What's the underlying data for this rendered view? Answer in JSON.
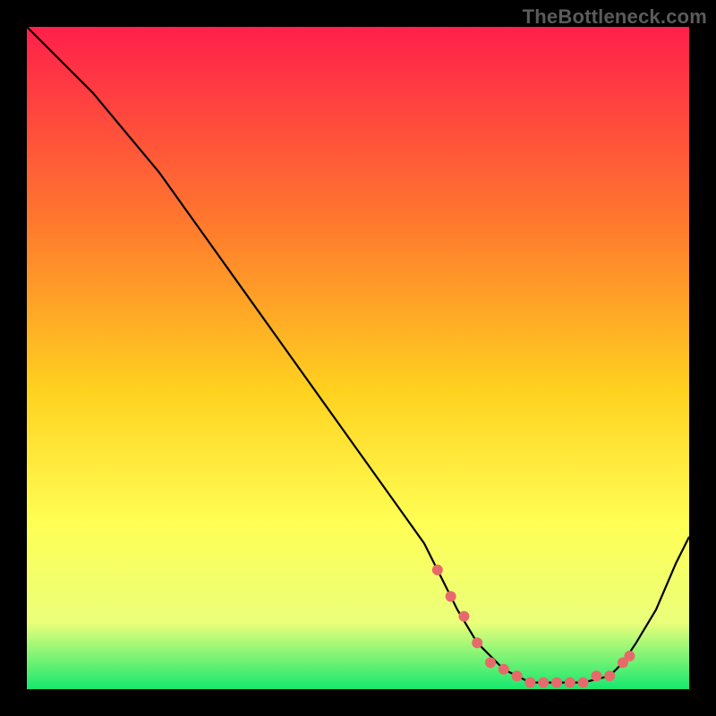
{
  "watermark": "TheBottleneck.com",
  "colors": {
    "gradient_top": "#ff1f4b",
    "gradient_mid1": "#ff7a2d",
    "gradient_mid2": "#ffd21f",
    "gradient_mid3": "#ffff55",
    "gradient_mid4": "#eaff7a",
    "gradient_bottom": "#16e86f",
    "curve": "#000000",
    "dots": "#e76a6a",
    "frame": "#000000"
  },
  "chart_data": {
    "type": "line",
    "title": "",
    "xlabel": "",
    "ylabel": "",
    "xlim": [
      0,
      100
    ],
    "ylim": [
      0,
      100
    ],
    "series": [
      {
        "name": "curve",
        "x": [
          0,
          6,
          10,
          15,
          20,
          25,
          30,
          35,
          40,
          45,
          50,
          55,
          60,
          62,
          65,
          68,
          72,
          76,
          80,
          84,
          88,
          90,
          92,
          95,
          98,
          100
        ],
        "y": [
          100,
          94,
          90,
          84,
          78,
          71,
          64,
          57,
          50,
          43,
          36,
          29,
          22,
          18,
          12,
          7,
          3,
          1,
          1,
          1,
          2,
          4,
          7,
          12,
          19,
          23
        ]
      }
    ],
    "dots": {
      "x": [
        62,
        64,
        66,
        68,
        70,
        72,
        74,
        76,
        78,
        80,
        82,
        84,
        86,
        88,
        90,
        91
      ],
      "y": [
        18,
        14,
        11,
        7,
        4,
        3,
        2,
        1,
        1,
        1,
        1,
        1,
        2,
        2,
        4,
        5
      ]
    }
  }
}
